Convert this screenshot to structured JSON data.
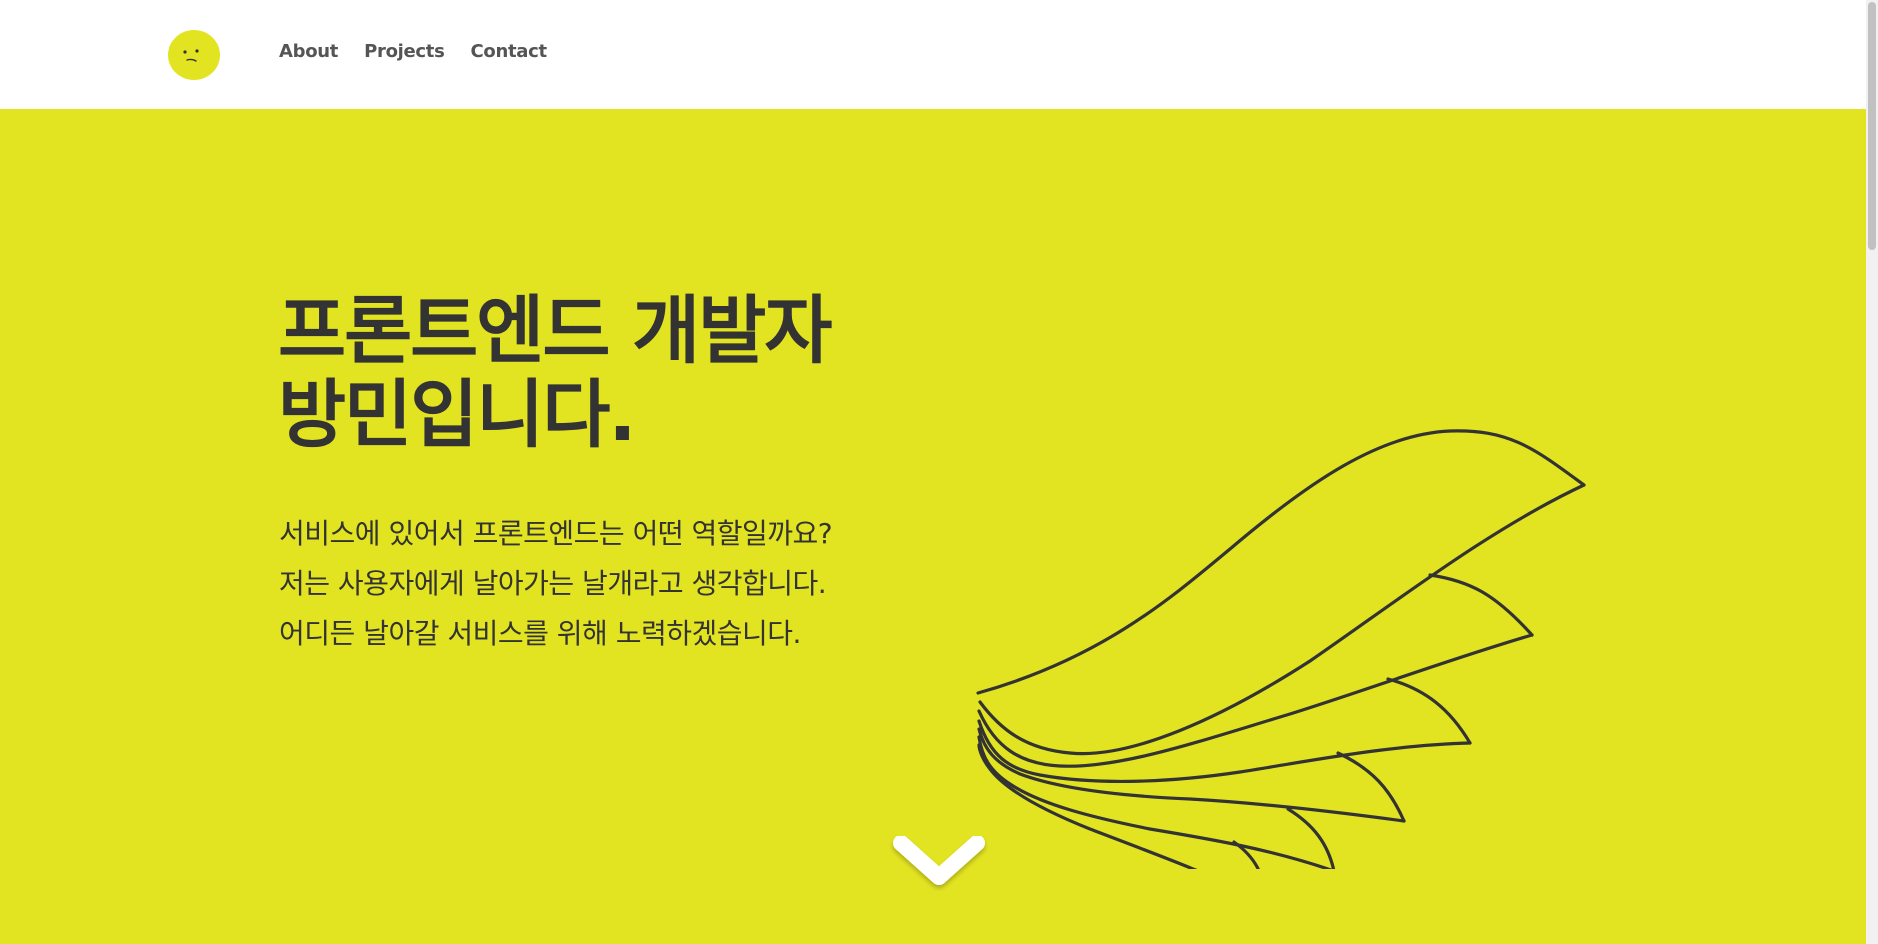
{
  "header": {
    "logo_icon": "confused-face-icon",
    "nav": [
      {
        "label": "About"
      },
      {
        "label": "Projects"
      },
      {
        "label": "Contact"
      }
    ]
  },
  "hero": {
    "title_line1": "프론트엔드 개발자",
    "title_line2": "방민입니다.",
    "description": [
      "서비스에 있어서 프론트엔드는 어떤 역할일까요?",
      "저는 사용자에게 날아가는 날개라고 생각합니다.",
      "어디든 날아갈 서비스를 위해 노력하겠습니다."
    ],
    "illustration_icon": "wing-icon",
    "scroll_icon": "chevron-down-icon"
  },
  "colors": {
    "accent": "#e3e421",
    "text": "#333333",
    "nav_text": "#555555",
    "background": "#ffffff"
  }
}
